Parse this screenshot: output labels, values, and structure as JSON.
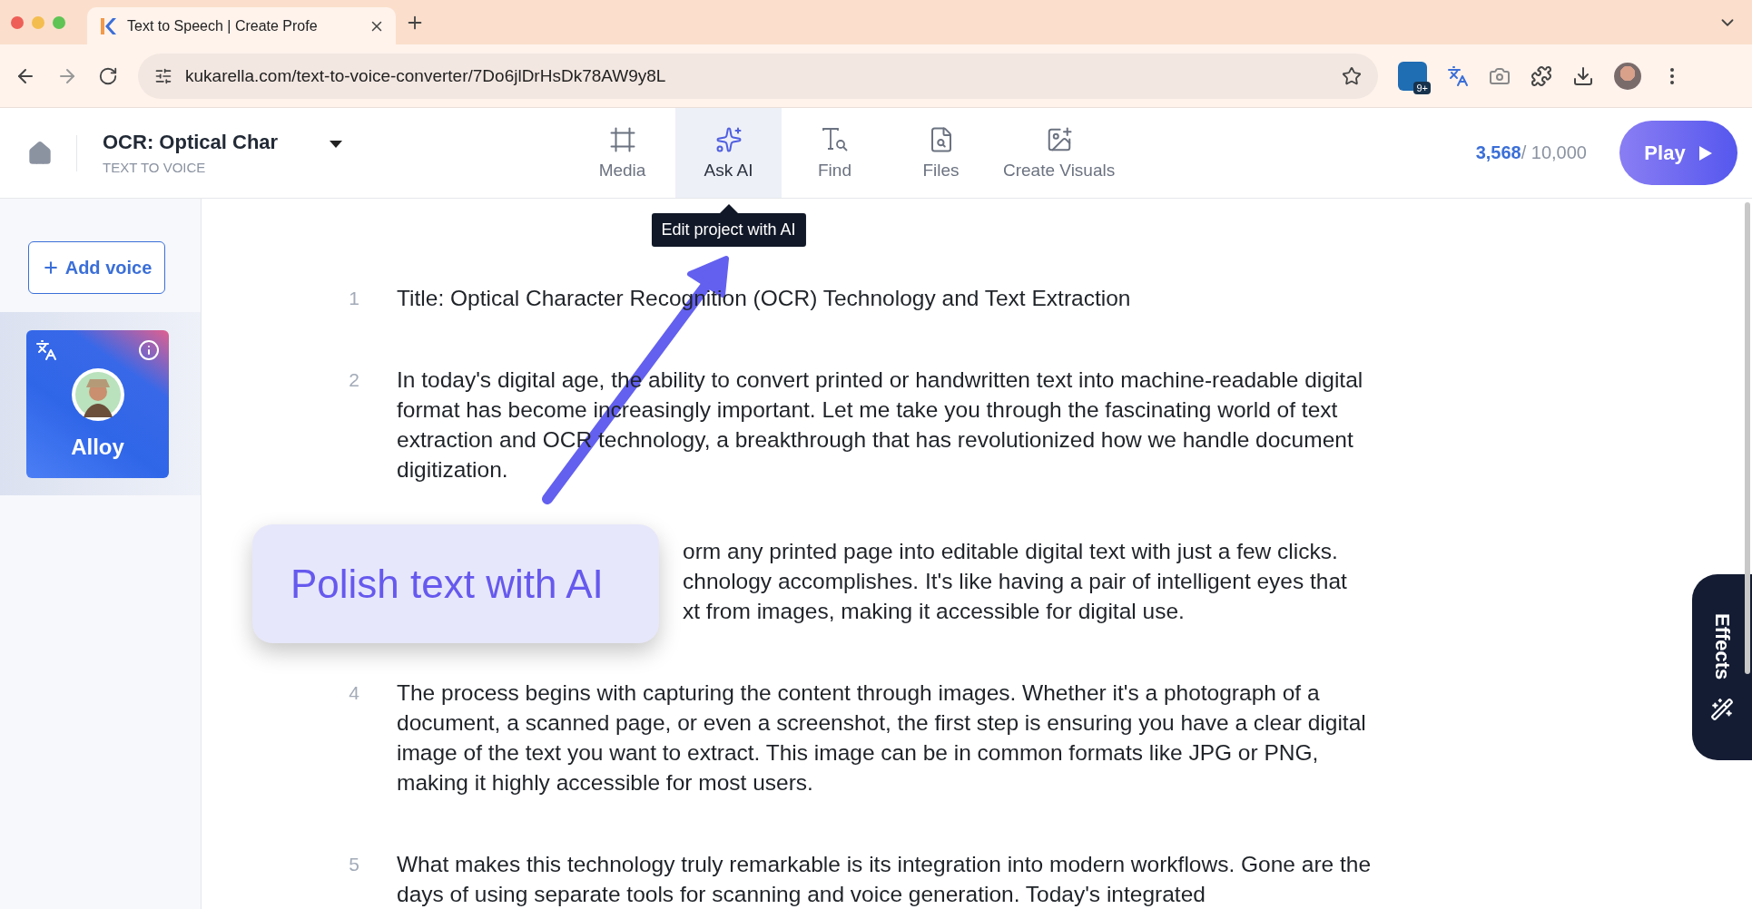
{
  "browser": {
    "tab_title": "Text to Speech | Create Profe",
    "url": "kukarella.com/text-to-voice-converter/7Do6jlDrHsDk78AW9y8L",
    "extension_badge": "9+"
  },
  "header": {
    "project_title": "OCR: Optical Char",
    "subtitle": "TEXT TO VOICE",
    "tools": [
      {
        "kind": "media",
        "label": "Media",
        "selected": false
      },
      {
        "kind": "ai",
        "label": "Ask AI",
        "selected": true
      },
      {
        "kind": "find",
        "label": "Find",
        "selected": false
      },
      {
        "kind": "files",
        "label": "Files",
        "selected": false
      },
      {
        "kind": "visuals",
        "label": "Create Visuals",
        "selected": false
      }
    ],
    "tooltip": "Edit project with AI",
    "credits_used": "3,568",
    "credits_total": "/ 10,000",
    "play_label": "Play"
  },
  "sidebar": {
    "add_voice": "Add voice",
    "voices": [
      {
        "name": "Alloy",
        "selected": true
      }
    ]
  },
  "paragraphs": [
    {
      "kind": "full",
      "number": "1",
      "text": "Title: Optical Character Recognition (OCR) Technology and Text Extraction"
    },
    {
      "kind": "full",
      "number": "2",
      "text": "In today's digital age, the ability to convert printed or handwritten text into machine-readable digital format has become increasingly important. Let me take you through the fascinating world of text extraction and OCR technology, a breakthrough that has revolutionized how we handle document digitization."
    },
    {
      "kind": "covered",
      "fragments": [
        "orm any printed page into editable digital text with just a few clicks.",
        "chnology accomplishes. It's like having a pair of intelligent eyes that",
        "xt from images, making it accessible for digital use."
      ]
    },
    {
      "kind": "full",
      "number": "4",
      "text": "The process begins with capturing the content through images. Whether it's a photograph of a document, a scanned page, or even a screenshot, the first step is ensuring you have a clear digital image of the text you want to extract. This image can be in common formats like JPG or PNG, making it highly accessible for most users."
    },
    {
      "kind": "full",
      "number": "5",
      "text": "What makes this technology truly remarkable is its integration into modern workflows. Gone are the days of using separate tools for scanning and voice generation. Today's integrated"
    }
  ],
  "callout": "Polish text with AI",
  "effects_tab": "Effects"
}
